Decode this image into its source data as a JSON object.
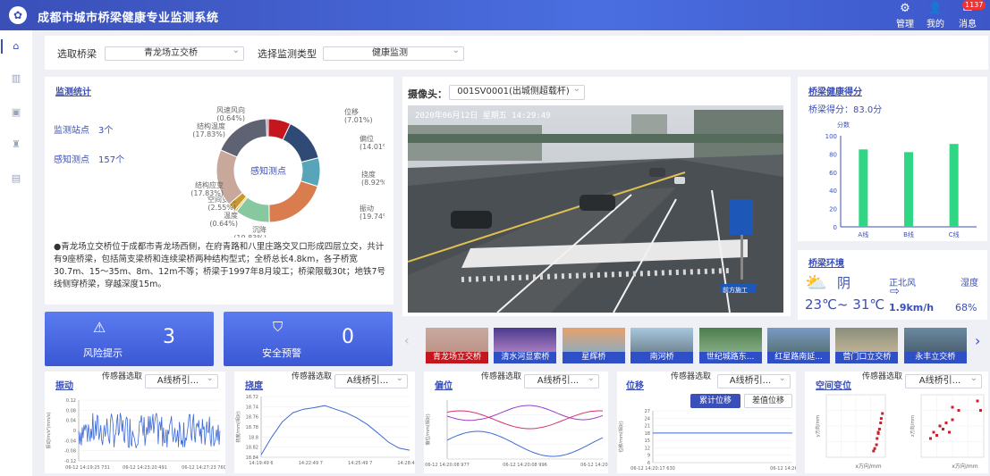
{
  "header": {
    "title": "成都市城市桥梁健康专业监测系统",
    "manage": "管理",
    "mine": "我的",
    "msg": "消息",
    "msg_count": "1137"
  },
  "sidebar": {
    "items": [
      "home-icon",
      "chart-icon",
      "image-icon",
      "alarm-icon",
      "document-icon"
    ]
  },
  "filters": {
    "bridge_label": "选取桥梁",
    "bridge_value": "青龙场立交桥",
    "type_label": "选择监测类型",
    "type_value": "健康监测"
  },
  "stats": {
    "title": "监测统计",
    "stations_label": "监测站点",
    "stations_value": "3个",
    "points_label": "感知测点",
    "points_value": "157个",
    "donut_center": "感知测点",
    "description": "●青龙场立交桥位于成都市青龙场西侧，在府青路和八里庄路交叉口形成四层立交，共计有9座桥梁，包括简支梁桥和连续梁桥两种结构型式；全桥总长4.8km，各子桥宽30.7m、15～35m、8m、12m不等；桥梁于1997年8月竣工；桥梁限载30t；地铁7号线侧穿桥梁，穿越深度15m。",
    "segments": [
      {
        "name": "位移",
        "pct": "(7.01%)",
        "value": 7.01,
        "color": "#c4161c"
      },
      {
        "name": "偏位",
        "pct": "(14.01%)",
        "value": 14.01,
        "color": "#2f4a74"
      },
      {
        "name": "挠度",
        "pct": "(8.92%)",
        "value": 8.92,
        "color": "#58a4b8"
      },
      {
        "name": "振动",
        "pct": "(19.74%)",
        "value": 19.74,
        "color": "#d97d4e"
      },
      {
        "name": "沉降",
        "pct": "(10.83%)",
        "value": 10.83,
        "color": "#86c8a0"
      },
      {
        "name": "温度",
        "pct": "(0.64%)",
        "value": 0.64,
        "color": "#e8b64a"
      },
      {
        "name": "空间变位",
        "pct": "(2.55%)",
        "value": 2.55,
        "color": "#c99a2a"
      },
      {
        "name": "结构应变",
        "pct": "(17.83%)",
        "value": 17.83,
        "color": "#c9a89c"
      },
      {
        "name": "结构温度",
        "pct": "(17.83%)",
        "value": 17.83,
        "color": "#5f6272"
      },
      {
        "name": "风速风向",
        "pct": "(0.64%)",
        "value": 0.64,
        "color": "#8a8f9c"
      }
    ]
  },
  "camera": {
    "label": "摄像头：",
    "value": "001SV0001(出城侧超载杆)",
    "timestamp": "2020年06月12日 星期五 14:29:49",
    "sign": "前方施工"
  },
  "alerts": {
    "risk_label": "风险提示",
    "risk_value": "3",
    "warn_label": "安全预警",
    "warn_value": "0"
  },
  "thumbs": [
    "青龙场立交桥",
    "清水河显索桥",
    "星辉桥",
    "南河桥",
    "世纪城路东...",
    "红星路南延...",
    "营门口立交桥",
    "永丰立交桥"
  ],
  "score": {
    "title": "桥梁健康得分",
    "subtitle": "桥梁得分：83.0分",
    "unit": "分数"
  },
  "env": {
    "title": "桥梁环境",
    "weather": "阴",
    "temp": "23℃~ 31℃",
    "wind_dir": "正北风",
    "wind_speed": "1.9km/h",
    "humidity_label": "湿度",
    "humidity": "68%"
  },
  "charts": {
    "vib": {
      "title": "振动",
      "sensor_label": "传感器选取",
      "sensor_value": "A线桥引...",
      "ylabel": "振动/m/s²(mm/s)",
      "x": [
        "06-12 14:19:25 731",
        "06-12 14:23:20 491",
        "06-12 14:27:23 760"
      ]
    },
    "defl": {
      "title": "挠度",
      "sensor_label": "传感器选取",
      "sensor_value": "A线桥引...",
      "ylabel": "挠度/mm(相对)",
      "x": [
        "14:19:49 6",
        "14:22:49 7",
        "14:25:49 7",
        "14:28:49 7"
      ]
    },
    "offset": {
      "title": "偏位",
      "sensor_label": "传感器选取",
      "sensor_value": "A线桥引...",
      "ylabel": "偏位/mm(相对)",
      "x": [
        "06-12 14:20:08 977",
        "06-12 14:20:08 996",
        "06-12 14:20:09 033"
      ]
    },
    "disp": {
      "title": "位移",
      "sensor_label": "传感器选取",
      "sensor_value": "A线桥引...",
      "btn1": "累计位移",
      "btn2": "差值位移",
      "ylabel": "位移/mm(相对)",
      "x": [
        "06-12 14:20:17 630",
        "06-12 14:26:17 669"
      ]
    },
    "space": {
      "title": "空间变位",
      "sensor_label": "传感器选取",
      "sensor_value": "A线桥引...",
      "ylabel1": "y方向/mm",
      "ylabel2": "z方向/mm",
      "xlabel1": "x方向/mm",
      "xlabel2": "x方向/mm"
    }
  },
  "chart_data": [
    {
      "type": "bar",
      "title": "桥梁健康得分",
      "ylabel": "分数",
      "categories": [
        "A线",
        "B线",
        "C线"
      ],
      "values": [
        85,
        82,
        91
      ],
      "ylim": [
        0,
        100
      ],
      "yticks": [
        "0",
        "20",
        "40",
        "60",
        "80",
        "100"
      ],
      "color": "#2fd683"
    },
    {
      "type": "line",
      "title": "振动",
      "yticks": [
        "0.12",
        "0.08",
        "0.04",
        "0",
        "-0.04",
        "-0.08",
        "-0.12"
      ],
      "ylim": [
        -0.12,
        0.12
      ]
    },
    {
      "type": "line",
      "title": "挠度",
      "yticks": [
        "18.72",
        "18.74",
        "18.76",
        "18.78",
        "18.8",
        "18.82",
        "18.84"
      ],
      "ylim": [
        18.72,
        18.84
      ],
      "values": [
        18.835,
        18.8,
        18.77,
        18.752,
        18.745,
        18.742,
        18.738,
        18.745,
        18.752,
        18.762,
        18.775,
        18.792,
        18.81,
        18.822,
        18.826
      ]
    },
    {
      "type": "line",
      "title": "位移",
      "yticks": [
        "27",
        "24",
        "21",
        "18",
        "15",
        "12",
        "9",
        "6"
      ],
      "ylim": [
        6,
        27
      ],
      "values": [
        18,
        18,
        18,
        18
      ]
    }
  ]
}
